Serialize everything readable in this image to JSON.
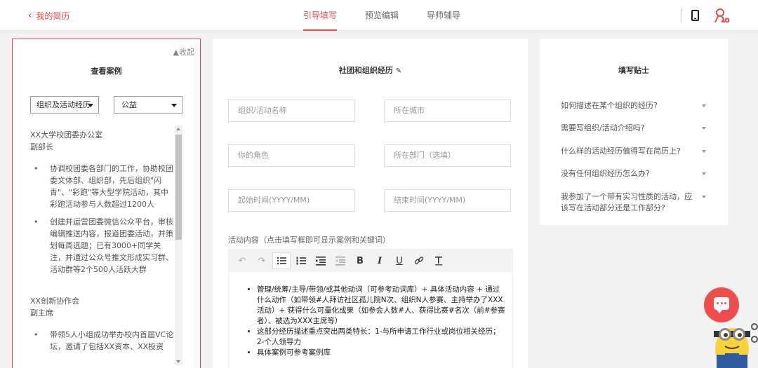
{
  "header": {
    "back_label": "我的简历",
    "tabs": [
      "引导填写",
      "预览编辑",
      "导师辅导"
    ]
  },
  "case_panel": {
    "collapse_label": "收起",
    "title": "查看案例",
    "category_value": "组织及活动经历",
    "type_value": "公益",
    "cases": [
      {
        "org": "XX大学校团委办公室",
        "role": "副部长",
        "bullets": [
          "协调校团委各部门的工作，协助校团委文体部、组织部，先后组织\"闪青\"、\"彩跑\"等大型学院活动，其中彩跑活动参与人数超过1200人",
          "创建并运营团委微信公众平台，审核编辑推送内容，报道团委活动，并策划每周选题；已有3000+同学关注，并通过公众号推文形成实习群、活动群等2个500人活跃大群"
        ]
      },
      {
        "org": "XX创新协作会",
        "role": "副主席",
        "bullets": [
          "带领5人小组成功举办校内首届VC论坛，邀请了包括XX资本、XX投资"
        ]
      }
    ]
  },
  "form": {
    "title": "社团和组织经历",
    "placeholders": {
      "org_name": "组织/活动名称",
      "city": "所在城市",
      "role": "你的角色",
      "department": "所在部门（选填）",
      "start": "起始时间(YYYY/MM)",
      "end": "结束时间(YYYY/MM)"
    },
    "content_label": "活动内容（点击填写框即可显示案例和关键词）",
    "toolbar": {
      "bold": "B",
      "italic": "I",
      "underline": "U"
    },
    "editor_items": [
      "管理/统筹/主导/带领/或其他动词（可参考动词库）+ 具体活动内容 + 通过什么动作（如带领#人拜访社区孤儿院N次、组织N人参赛、主持举办了XXX活动）+ 获得什么可量化成果（如参会人数#人、获得比赛#名次（前#参赛者）、被选为XXX主席等）",
      "这部分经历描述重点突出两类特长：1-与所申请工作行业或岗位相关经历；2-个人领导力",
      "具体案例可参考案例库"
    ]
  },
  "tips": {
    "title": "填写贴士",
    "items": [
      "如何描述在某个组织的经历?",
      "需要写组织/活动介绍吗?",
      "什么样的活动经历值得写在简历上?",
      "没有任何组织经历怎么办?",
      "我参加了一个带有实习性质的活动，应该写在活动部分还是工作部分?"
    ]
  },
  "colors": {
    "accent": "#e8474b",
    "chat": "#ee4e4b"
  }
}
